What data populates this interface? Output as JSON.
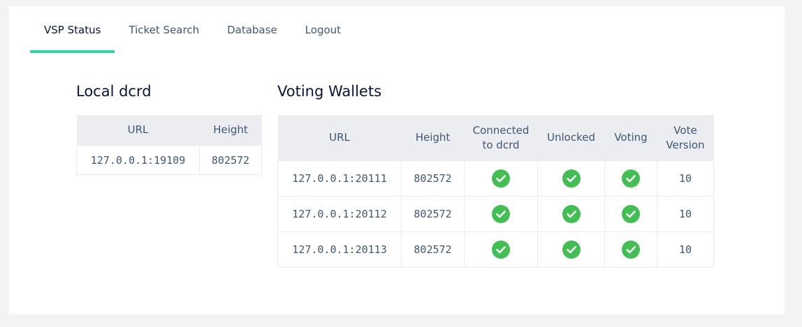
{
  "nav": {
    "tabs": [
      {
        "label": "VSP Status",
        "active": true
      },
      {
        "label": "Ticket Search",
        "active": false
      },
      {
        "label": "Database",
        "active": false
      },
      {
        "label": "Logout",
        "active": false
      }
    ]
  },
  "local_dcrd": {
    "title": "Local dcrd",
    "headers": {
      "url": "URL",
      "height": "Height"
    },
    "row": {
      "url": "127.0.0.1:19109",
      "height": "802572"
    }
  },
  "voting_wallets": {
    "title": "Voting Wallets",
    "headers": {
      "url": "URL",
      "height": "Height",
      "connected_line1": "Connected",
      "connected_line2": "to dcrd",
      "unlocked": "Unlocked",
      "voting": "Voting",
      "version_line1": "Vote",
      "version_line2": "Version"
    },
    "rows": [
      {
        "url": "127.0.0.1:20111",
        "height": "802572",
        "connected": "check-circle-icon",
        "unlocked": "check-circle-icon",
        "voting": "check-circle-icon",
        "version": "10"
      },
      {
        "url": "127.0.0.1:20112",
        "height": "802572",
        "connected": "check-circle-icon",
        "unlocked": "check-circle-icon",
        "voting": "check-circle-icon",
        "version": "10"
      },
      {
        "url": "127.0.0.1:20113",
        "height": "802572",
        "connected": "check-circle-icon",
        "unlocked": "check-circle-icon",
        "voting": "check-circle-icon",
        "version": "10"
      }
    ]
  },
  "colors": {
    "page_background": "#f2f3f5",
    "panel_background": "#ffffff",
    "active_tab_underline": "#2ed6a1",
    "check_icon": "#41bf53",
    "table_header_background": "#ebedf0"
  }
}
